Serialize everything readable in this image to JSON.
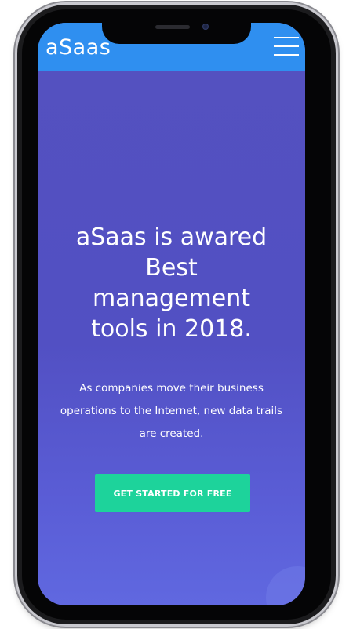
{
  "header": {
    "brand": "aSaas",
    "menu_icon": "hamburger-menu-icon"
  },
  "hero": {
    "title_lines": [
      "aSaas is awared",
      "Best",
      "management",
      "tools in 2018."
    ],
    "subtitle_lines": [
      "As companies move their business",
      "operations to the Internet, new data trails",
      "are created."
    ],
    "cta_label": "GET STARTED FOR FREE"
  },
  "colors": {
    "header_bg": "#2f8ff0",
    "hero_bg": "#5451bf",
    "cta_bg": "#1dd39b",
    "text": "#ffffff"
  }
}
